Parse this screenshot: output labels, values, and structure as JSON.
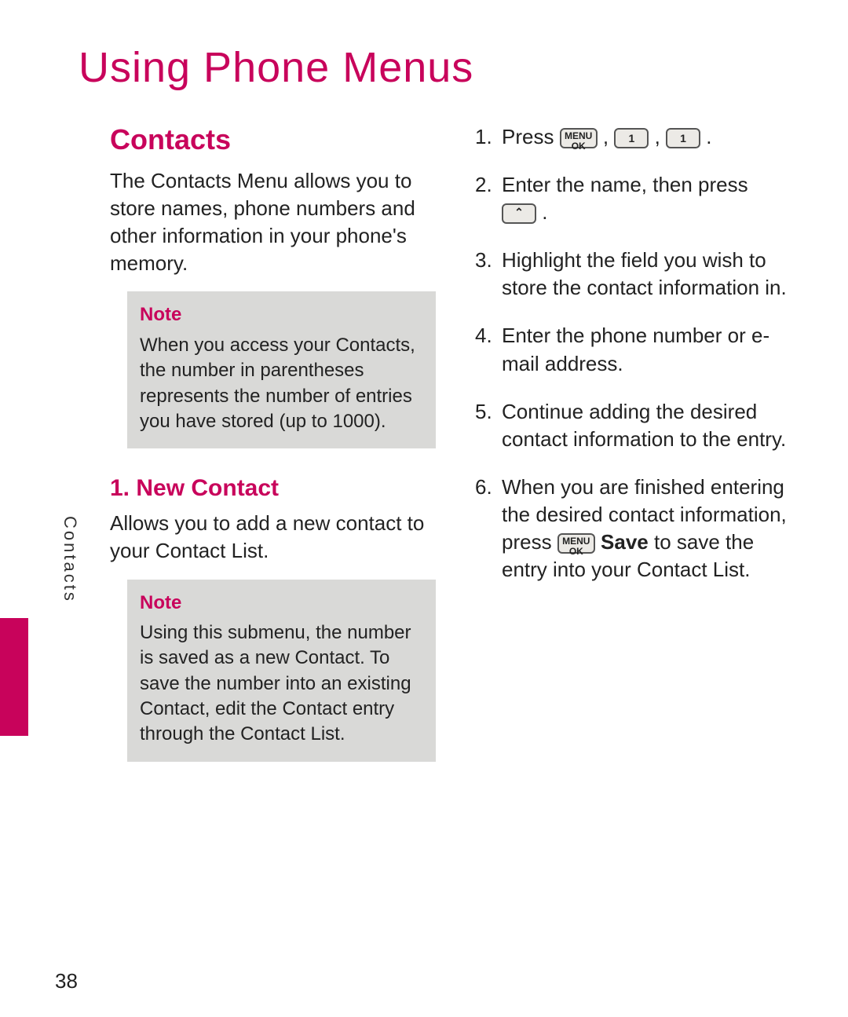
{
  "chapter_title": "Using Phone Menus",
  "side_label": "Contacts",
  "page_number": "38",
  "left": {
    "section_heading": "Contacts",
    "intro": "The Contacts Menu allows you to store names, phone numbers and other information in your phone's memory.",
    "note1_title": "Note",
    "note1_body": "When you access your Contacts, the number in parentheses represents the number of entries you have stored (up to 1000).",
    "sub_heading": "1. New Contact",
    "sub_intro": "Allows you to add a new contact to your Contact List.",
    "note2_title": "Note",
    "note2_body": "Using this submenu, the number is saved as a new Contact. To save the number into an existing Contact, edit the Contact entry through the Contact List."
  },
  "right": {
    "step1_prefix": "Press ",
    "step1_suffix": " .",
    "key_menu_ok_line1": "MENU",
    "key_menu_ok_line2": "OK",
    "key_one": "1",
    "comma": " , ",
    "step2_a": "Enter the name, then press ",
    "step2_b": " .",
    "step3": "Highlight the field you wish to store the contact information in.",
    "step4": "Enter the phone number or e-mail address.",
    "step5": "Continue adding the desired contact information to the entry.",
    "step6_a": "When you are finished entering the desired contact information, press ",
    "step6_save": " Save",
    "step6_b": " to save the entry into your Contact List."
  }
}
